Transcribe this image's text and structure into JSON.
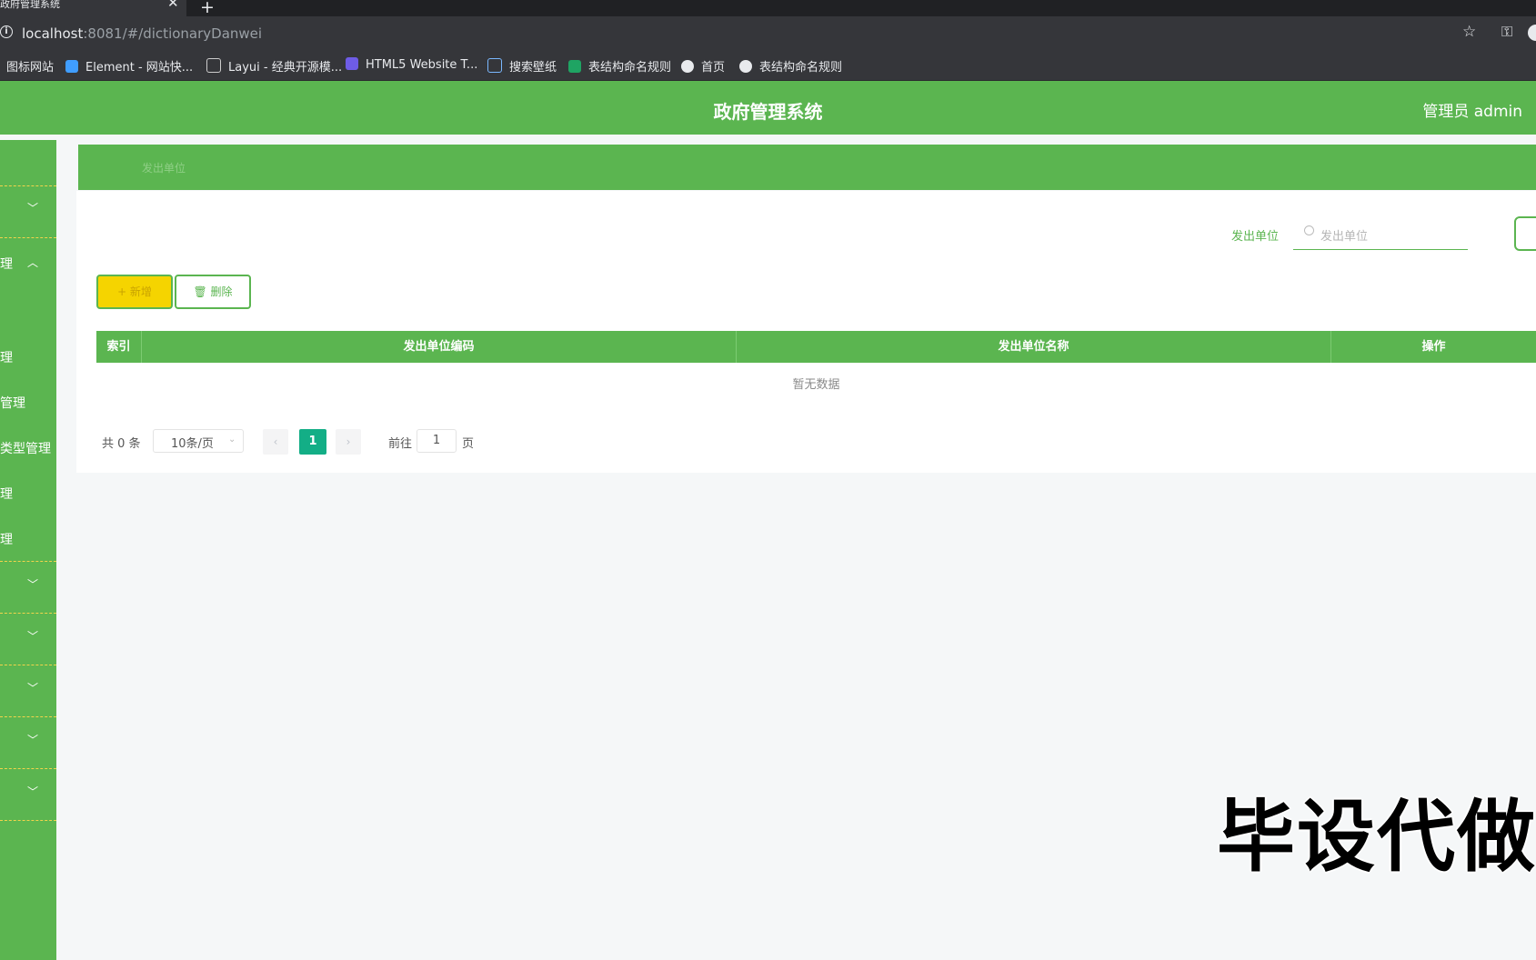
{
  "browser": {
    "tab_title": "政府管理系统",
    "close_glyph": "✕",
    "new_tab_glyph": "+",
    "url_host": "localhost",
    "url_rest": ":8081/#/dictionaryDanwei",
    "bookmarks": [
      {
        "label": "图标网站",
        "icon": "none"
      },
      {
        "label": "Element - 网站快...",
        "icon": "element-icon"
      },
      {
        "label": "Layui - 经典开源模...",
        "icon": "layui-icon"
      },
      {
        "label": "HTML5 Website T...",
        "icon": "html5-icon"
      },
      {
        "label": "搜索壁纸",
        "icon": "wallpaper-icon"
      },
      {
        "label": "表结构命名规则",
        "icon": "sheet-icon"
      },
      {
        "label": "首页",
        "icon": "globe-icon"
      },
      {
        "label": "表结构命名规则",
        "icon": "globe-icon"
      }
    ]
  },
  "header": {
    "title": "政府管理系统",
    "user": "管理员 admin"
  },
  "sidebar": {
    "items": [
      {
        "label": "",
        "chevron": "﹀"
      },
      {
        "label": "理",
        "chevron": "︿"
      },
      {
        "label": "理",
        "chevron": ""
      },
      {
        "label": "管理",
        "chevron": ""
      },
      {
        "label": "类型管理",
        "chevron": ""
      },
      {
        "label": "理",
        "chevron": ""
      },
      {
        "label": "理",
        "chevron": ""
      },
      {
        "label": "",
        "chevron": "﹀"
      },
      {
        "label": "",
        "chevron": "﹀"
      },
      {
        "label": "",
        "chevron": "﹀"
      },
      {
        "label": "",
        "chevron": "﹀"
      },
      {
        "label": "",
        "chevron": "﹀"
      }
    ]
  },
  "breadcrumb": "发出单位",
  "search": {
    "label": "发出单位",
    "placeholder": "发出单位",
    "query_glyph": "Q"
  },
  "actions": {
    "add": "+ 新增",
    "delete": "🗑 删除"
  },
  "table": {
    "columns": [
      "索引",
      "发出单位编码",
      "发出单位名称",
      "操作"
    ],
    "rows": [],
    "empty_text": "暂无数据"
  },
  "pagination": {
    "total": "共 0 条",
    "page_size": "10条/页",
    "current": "1",
    "goto_label": "前往",
    "goto_value": "1",
    "page_suffix": "页",
    "prev_glyph": "‹",
    "next_glyph": "›",
    "size_caret": "⌄"
  },
  "watermark": "毕设代做",
  "colors": {
    "primary_green": "#5bb550",
    "add_yellow": "#f5d400",
    "current_page": "#13ae86"
  }
}
